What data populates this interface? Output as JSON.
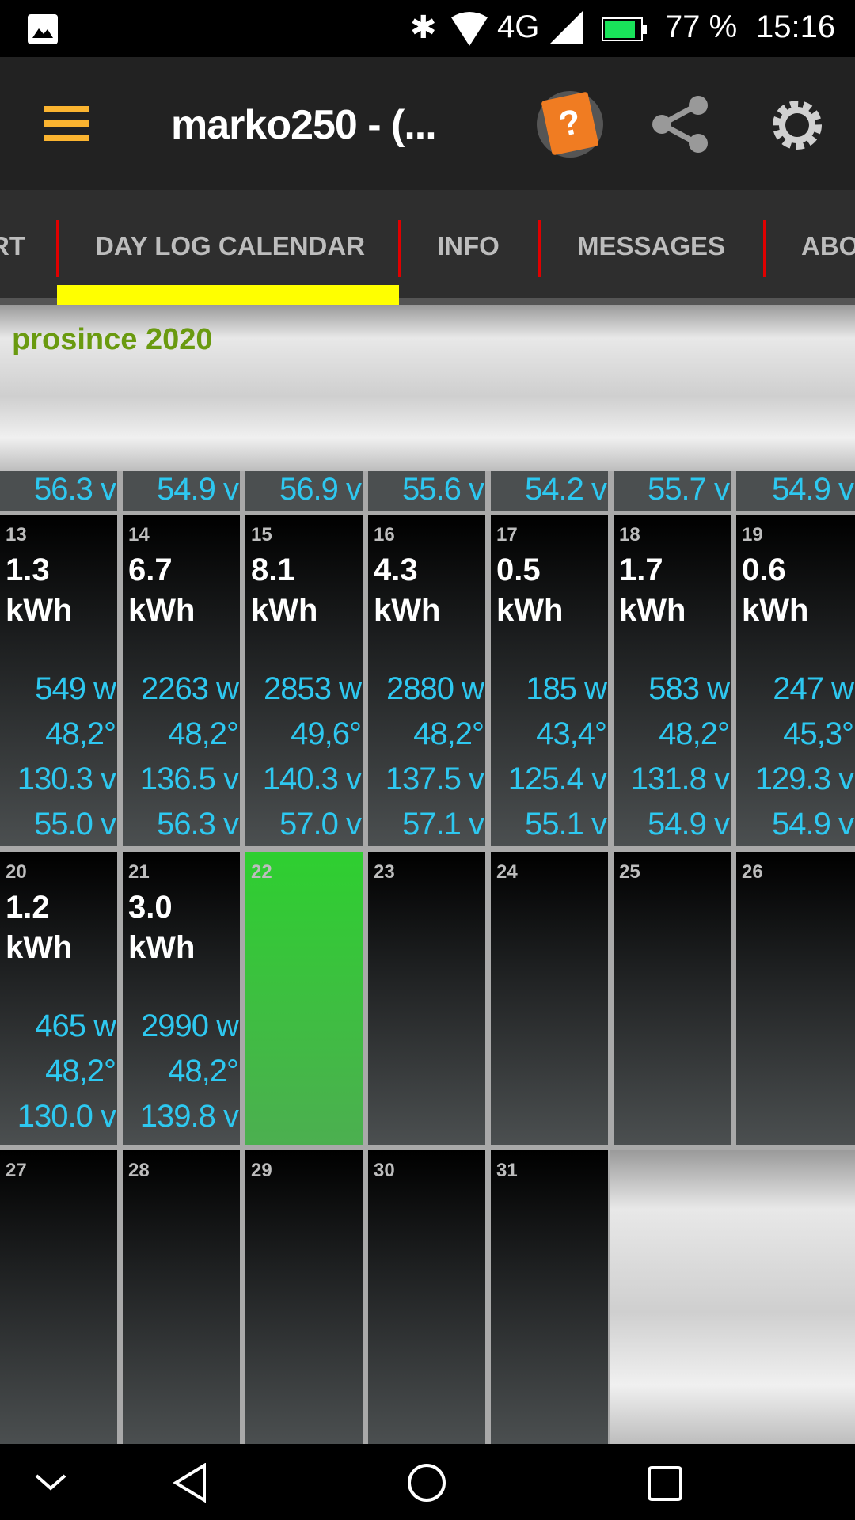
{
  "status_bar": {
    "battery": "77 %",
    "time": "15:16",
    "network": "4G"
  },
  "app_bar": {
    "title": "marko250 - (..."
  },
  "tabs": [
    {
      "label": "RT"
    },
    {
      "label": "DAY LOG CALENDAR",
      "active": true
    },
    {
      "label": "INFO"
    },
    {
      "label": "MESSAGES"
    },
    {
      "label": "ABO"
    }
  ],
  "month": "prosince 2020",
  "partial_row": [
    "56.3 v",
    "54.9 v",
    "56.9 v",
    "55.6 v",
    "54.2 v",
    "55.7 v",
    "54.9 v"
  ],
  "weeks": [
    [
      {
        "day": "13",
        "kwh": "1.3",
        "unit": "kWh",
        "power": "549 w",
        "temp": "48,2°",
        "v1": "130.3 v",
        "v2": "55.0 v"
      },
      {
        "day": "14",
        "kwh": "6.7",
        "unit": "kWh",
        "power": "2263 w",
        "temp": "48,2°",
        "v1": "136.5 v",
        "v2": "56.3 v"
      },
      {
        "day": "15",
        "kwh": "8.1",
        "unit": "kWh",
        "power": "2853 w",
        "temp": "49,6°",
        "v1": "140.3 v",
        "v2": "57.0 v"
      },
      {
        "day": "16",
        "kwh": "4.3",
        "unit": "kWh",
        "power": "2880 w",
        "temp": "48,2°",
        "v1": "137.5 v",
        "v2": "57.1 v"
      },
      {
        "day": "17",
        "kwh": "0.5",
        "unit": "kWh",
        "power": "185 w",
        "temp": "43,4°",
        "v1": "125.4 v",
        "v2": "55.1 v"
      },
      {
        "day": "18",
        "kwh": "1.7",
        "unit": "kWh",
        "power": "583 w",
        "temp": "48,2°",
        "v1": "131.8 v",
        "v2": "54.9 v"
      },
      {
        "day": "19",
        "kwh": "0.6",
        "unit": "kWh",
        "power": "247 w",
        "temp": "45,3°",
        "v1": "129.3 v",
        "v2": "54.9 v"
      }
    ],
    [
      {
        "day": "20",
        "kwh": "1.2",
        "unit": "kWh",
        "power": "465 w",
        "temp": "48,2°",
        "v1": "130.0 v"
      },
      {
        "day": "21",
        "kwh": "3.0",
        "unit": "kWh",
        "power": "2990 w",
        "temp": "48,2°",
        "v1": "139.8 v"
      },
      {
        "day": "22",
        "today": true
      },
      {
        "day": "23"
      },
      {
        "day": "24"
      },
      {
        "day": "25"
      },
      {
        "day": "26"
      }
    ],
    [
      {
        "day": "27"
      },
      {
        "day": "28"
      },
      {
        "day": "29"
      },
      {
        "day": "30"
      },
      {
        "day": "31"
      }
    ]
  ],
  "colors": {
    "accent": "#ffff00",
    "tab_separator": "#e00000",
    "value_blue": "#2ec8f0",
    "today": "#2ecf30",
    "month": "#6a9a10"
  }
}
